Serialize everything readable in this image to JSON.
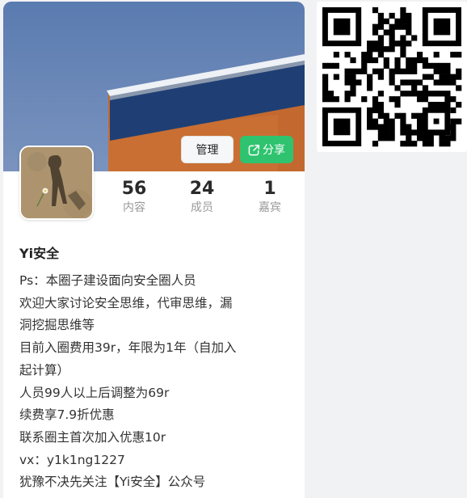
{
  "header": {
    "manage_label": "管理",
    "share_label": "分享"
  },
  "stats": [
    {
      "value": "56",
      "label": "内容"
    },
    {
      "value": "24",
      "label": "成员"
    },
    {
      "value": "1",
      "label": "嘉宾"
    }
  ],
  "group": {
    "name": "Yi安全",
    "description_lines": [
      "Ps：本圈子建设面向安全圈人员",
      "欢迎大家讨论安全思维，代审思维，漏",
      "洞挖掘思维等",
      "目前入圈费用39r，年限为1年（自加入",
      "起计算）",
      "人员99人以上后调整为69r",
      "续费享7.9折优惠",
      "联系圈主首次加入优惠10r",
      "vx：y1k1ng1227",
      "犹豫不决先关注【Yi安全】公众号"
    ]
  },
  "icons": {
    "share": "share-icon",
    "qr": "qr-code"
  },
  "colors": {
    "share_button": "#2fc36f",
    "sky": "#5f7fb3",
    "roof": "#1f3f74",
    "wall": "#c96f33"
  }
}
